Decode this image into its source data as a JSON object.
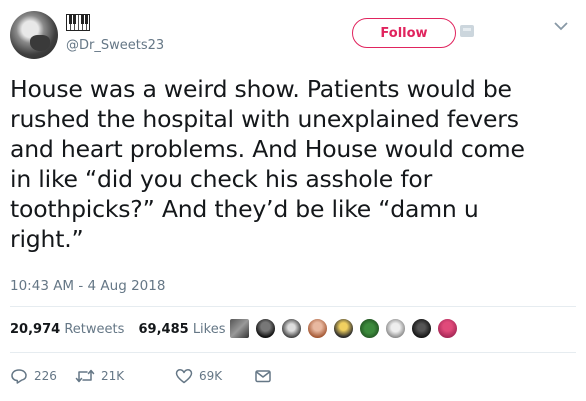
{
  "tweet": {
    "handle": "@Dr_Sweets23",
    "follow_label": "Follow",
    "text": "House was a weird show. Patients would be\nrushed the hospital with unexplained fevers\nand heart problems. And House would come\nin like “did you check his asshole for\ntoothpicks?” And they’d be like “damn u\nright.”",
    "timestamp": "10:43 AM - 4 Aug 2018"
  },
  "stats": {
    "retweets_count": "20,974",
    "retweets_label": "Retweets",
    "likes_count": "69,485",
    "likes_label": "Likes"
  },
  "actions": {
    "replies": "226",
    "retweets": "21K",
    "likes": "69K"
  },
  "colors": {
    "follow_accent": "#e0245e",
    "muted_text": "#657786",
    "primary_text": "#14171a"
  },
  "icons": [
    "piano-icon",
    "direct-message-icon",
    "chevron-down-icon",
    "reply-icon",
    "retweet-icon",
    "like-icon",
    "message-icon"
  ]
}
